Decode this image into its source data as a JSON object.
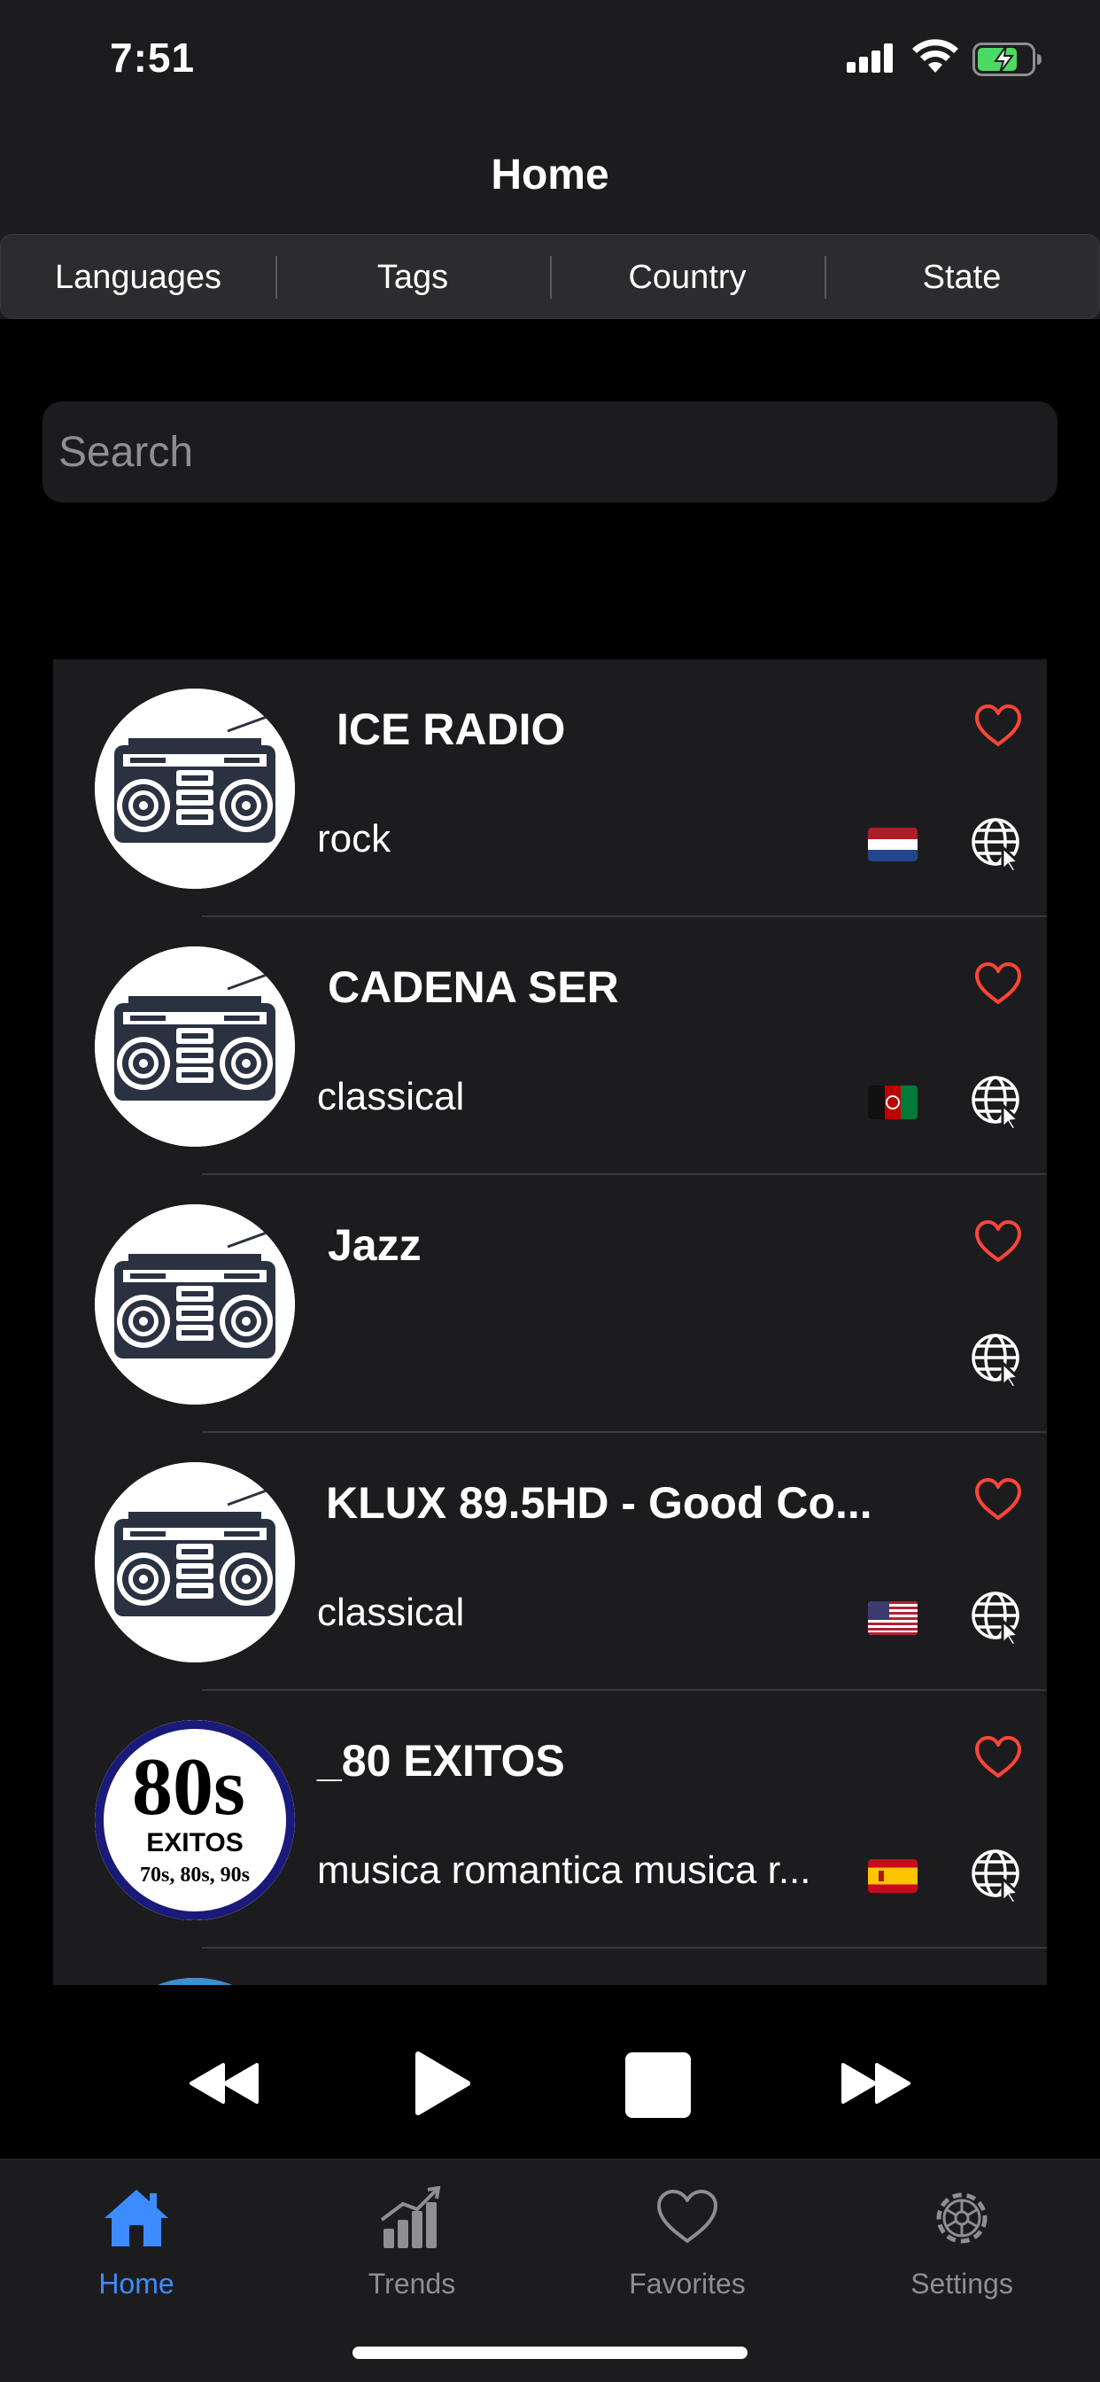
{
  "status_bar": {
    "time": "7:51"
  },
  "nav": {
    "title": "Home"
  },
  "segments": [
    "Languages",
    "Tags",
    "Country",
    "State"
  ],
  "search": {
    "placeholder": "Search",
    "value": ""
  },
  "stations": [
    {
      "name": "ICE RADIO",
      "tag": "rock",
      "flag": "netherlands",
      "logo": "boombox"
    },
    {
      "name": "CADENA SER",
      "tag": "classical",
      "flag": "afghanistan",
      "logo": "boombox"
    },
    {
      "name": "Jazz",
      "tag": "",
      "flag": "",
      "logo": "boombox"
    },
    {
      "name": "KLUX 89.5HD - Good Co...",
      "tag": "classical",
      "flag": "usa",
      "logo": "boombox"
    },
    {
      "name": "_80 EXITOS",
      "tag": "musica romantica musica r...",
      "flag": "spain",
      "logo": "80s-exitos",
      "logo_text": {
        "big": "80s",
        "mid": "EXITOS",
        "small": "70s, 80s, 90s"
      }
    }
  ],
  "player": {
    "controls": [
      "rewind-icon",
      "play-icon",
      "stop-icon",
      "fast-forward-icon"
    ]
  },
  "tabs": [
    {
      "label": "Home",
      "icon": "house-icon",
      "active": true
    },
    {
      "label": "Trends",
      "icon": "chart-icon",
      "active": false
    },
    {
      "label": "Favorites",
      "icon": "heart-icon",
      "active": false
    },
    {
      "label": "Settings",
      "icon": "gear-icon",
      "active": false
    }
  ],
  "colors": {
    "accent": "#3d8cff",
    "heart": "#ff453a",
    "background": "#000000",
    "surface": "#1c1c1e"
  }
}
